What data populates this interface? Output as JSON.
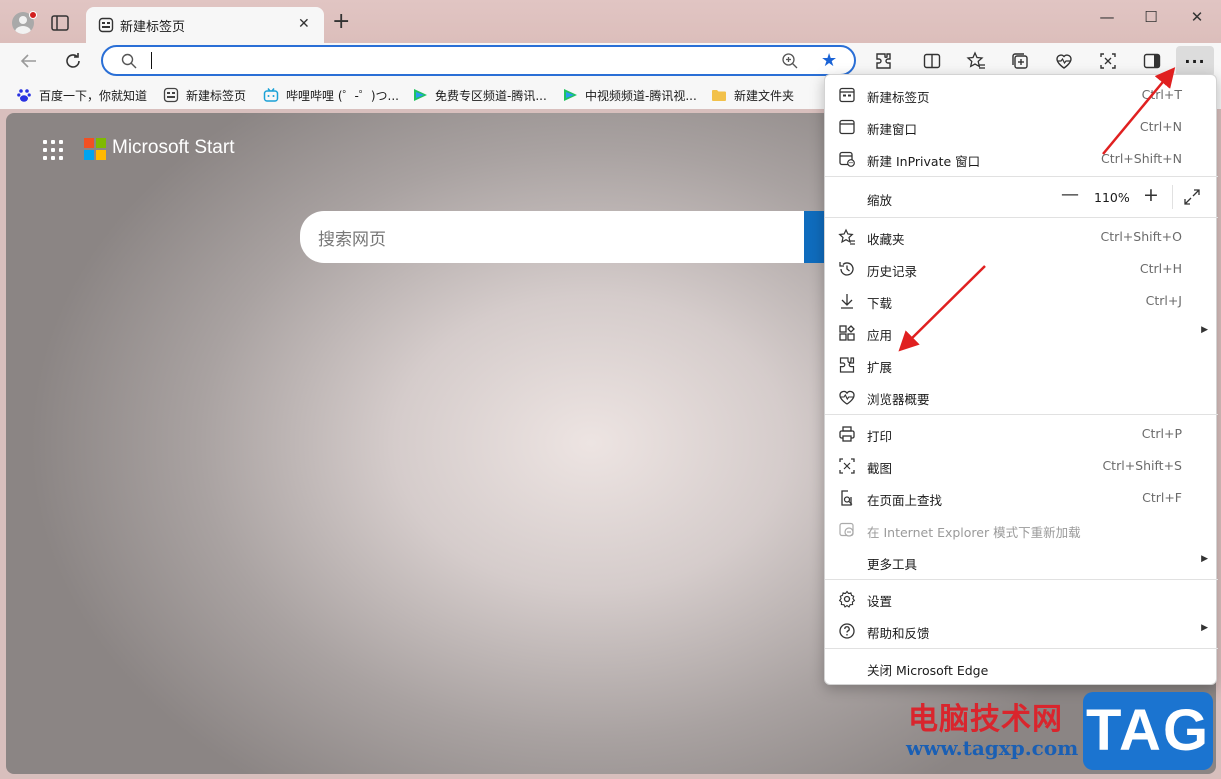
{
  "window": {
    "tab_title": "新建标签页",
    "close_tab": "✕",
    "new_tab": "+",
    "minimize": "—",
    "maximize": "☐",
    "close": "✕"
  },
  "address_bar": {
    "value": "",
    "placeholder": ""
  },
  "bookmarks": [
    {
      "label": "百度一下，你就知道",
      "icon": "baidu-paw-icon",
      "color": "#2932e1"
    },
    {
      "label": "新建标签页",
      "icon": "new-tab-page-icon",
      "color": "#444444"
    },
    {
      "label": "哔哩哔哩 (゜-゜)つ...",
      "icon": "bilibili-icon",
      "color": "#1aa1d6"
    },
    {
      "label": "免费专区频道-腾讯...",
      "icon": "tencent-video-icon",
      "color": "#1ec35f"
    },
    {
      "label": "中视频频道-腾讯视...",
      "icon": "tencent-video-icon",
      "color": "#1ec35f"
    },
    {
      "label": "新建文件夹",
      "icon": "folder-icon",
      "color": "#f2c14a"
    }
  ],
  "content": {
    "brand": "Microsoft Start",
    "search_placeholder": "搜索网页",
    "logo_colors": [
      "#f25022",
      "#7fba00",
      "#00a4ef",
      "#ffb900"
    ]
  },
  "menu": {
    "items": [
      {
        "label": "新建标签页",
        "shortcut": "Ctrl+T",
        "icon": "new-tab-icon"
      },
      {
        "label": "新建窗口",
        "shortcut": "Ctrl+N",
        "icon": "new-window-icon"
      },
      {
        "label": "新建 InPrivate 窗口",
        "shortcut": "Ctrl+Shift+N",
        "icon": "inprivate-icon"
      },
      {
        "label": "收藏夹",
        "shortcut": "Ctrl+Shift+O",
        "icon": "favorites-icon"
      },
      {
        "label": "历史记录",
        "shortcut": "Ctrl+H",
        "icon": "history-icon"
      },
      {
        "label": "下载",
        "shortcut": "Ctrl+J",
        "icon": "download-icon"
      },
      {
        "label": "应用",
        "shortcut": "",
        "icon": "apps-icon"
      },
      {
        "label": "扩展",
        "shortcut": "",
        "icon": "extensions-icon"
      },
      {
        "label": "浏览器概要",
        "shortcut": "",
        "icon": "browser-essentials-icon"
      },
      {
        "label": "打印",
        "shortcut": "Ctrl+P",
        "icon": "print-icon"
      },
      {
        "label": "截图",
        "shortcut": "Ctrl+Shift+S",
        "icon": "screenshot-icon"
      },
      {
        "label": "在页面上查找",
        "shortcut": "Ctrl+F",
        "icon": "find-icon"
      },
      {
        "label": "在 Internet Explorer 模式下重新加载",
        "shortcut": "",
        "icon": "ie-mode-icon"
      },
      {
        "label": "更多工具",
        "shortcut": "",
        "icon": ""
      },
      {
        "label": "设置",
        "shortcut": "",
        "icon": "settings-icon"
      },
      {
        "label": "帮助和反馈",
        "shortcut": "",
        "icon": "help-icon"
      },
      {
        "label": "关闭 Microsoft Edge",
        "shortcut": "",
        "icon": ""
      }
    ],
    "zoom": {
      "label": "缩放",
      "value": "110%",
      "minus": "—",
      "plus": "+"
    },
    "submenu_arrow": "▶"
  },
  "watermark": {
    "cn": "电脑技术网",
    "url": "www.tagxp.com",
    "tag": "TAG"
  },
  "colors": {
    "accent": "#1a63d6",
    "arrow": "#e02020",
    "more_active": "#dcdcdc"
  }
}
